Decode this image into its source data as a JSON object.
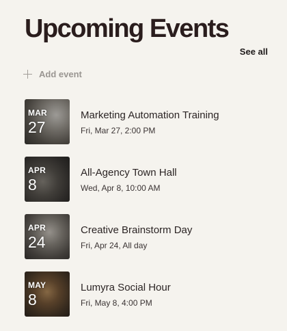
{
  "header": {
    "title": "Upcoming Events",
    "see_all_label": "See all"
  },
  "add_event": {
    "icon": "plus-icon",
    "label": "Add event"
  },
  "events": [
    {
      "month": "MAR",
      "day": "27",
      "title": "Marketing Automation Training",
      "datetime": "Fri, Mar 27, 2:00 PM"
    },
    {
      "month": "APR",
      "day": "8",
      "title": "All-Agency Town Hall",
      "datetime": "Wed, Apr 8, 10:00 AM"
    },
    {
      "month": "APR",
      "day": "24",
      "title": "Creative Brainstorm Day",
      "datetime": "Fri, Apr 24, All day"
    },
    {
      "month": "MAY",
      "day": "8",
      "title": "Lumyra Social Hour",
      "datetime": "Fri, May 8, 4:00 PM"
    }
  ],
  "colors": {
    "background": "#f5f3ee",
    "title": "#2a1d1d",
    "muted": "#9a9692"
  }
}
